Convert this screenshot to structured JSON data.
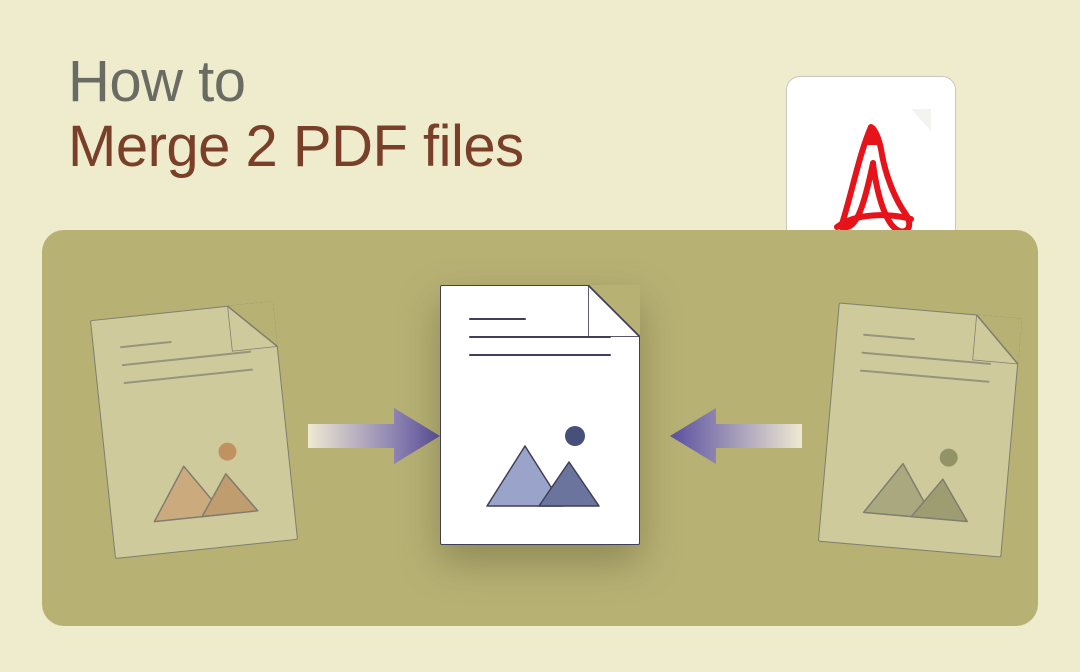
{
  "heading": {
    "line1": "How to",
    "line2": "Merge 2 PDF files"
  },
  "icons": {
    "left_doc": "document-image-icon",
    "center_doc": "document-image-icon",
    "right_doc": "document-image-icon",
    "arrow_left": "arrow-right-icon",
    "arrow_right": "arrow-left-icon",
    "pdf": "adobe-pdf-icon"
  },
  "colors": {
    "page_bg": "#eeeccd",
    "stage_bg": "#b7b174",
    "heading_muted": "#6a6b63",
    "heading_accent": "#7a3f28",
    "doc_border": "#53546a",
    "mountain_left_a": "#dca786",
    "mountain_left_b": "#c98d6b",
    "sun_left": "#c77a50",
    "mountain_center_a": "#9aa4ca",
    "mountain_center_b": "#6a749c",
    "sun_center": "#47507a",
    "mountain_right_a": "#9ea287",
    "mountain_right_b": "#8a8e72",
    "sun_right": "#777b60",
    "arrow_from": "#efe9d3",
    "arrow_to": "#5a4fa0",
    "adobe_red": "#e7131a"
  }
}
